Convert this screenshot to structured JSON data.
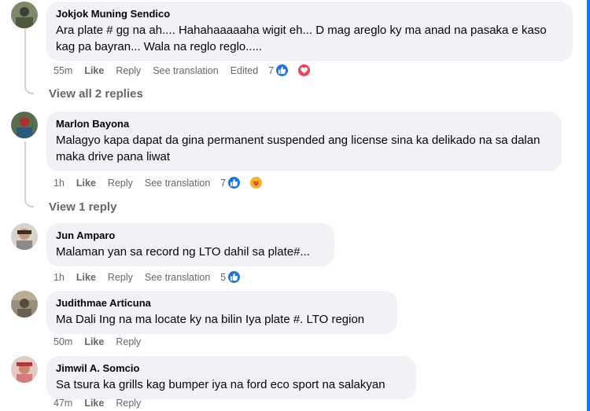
{
  "comments": [
    {
      "author": "Jokjok Muning Sendico",
      "text": "Ara plate # gg na ah.... Hahahaaaaaha wigit eh... D mag areglo ky ma anad na pasaka e kaso kag pa bayran... Wala na reglo reglo.....",
      "time": "55m",
      "like": "Like",
      "reply": "Reply",
      "translate": "See translation",
      "edited": "Edited",
      "reaction_count": "7",
      "reactions": [
        "like-icon",
        "love-icon"
      ],
      "view_replies": "View all 2 replies"
    },
    {
      "author": "Marlon Bayona",
      "text": "Malagyo kapa dapat da gina permanent suspended ang license sina ka delikado na sa dalan maka drive pana liwat",
      "time": "1h",
      "like": "Like",
      "reply": "Reply",
      "translate": "See translation",
      "reaction_count": "7",
      "reactions": [
        "like-icon",
        "care-icon"
      ],
      "view_replies": "View 1 reply"
    },
    {
      "author": "Jun Amparo",
      "text": "Malaman yan sa record ng LTO dahil sa plate#...",
      "time": "1h",
      "like": "Like",
      "reply": "Reply",
      "translate": "See translation",
      "reaction_count": "5",
      "reactions": [
        "like-icon"
      ]
    },
    {
      "author": "Judithmae Articuna",
      "text": "Ma Dali Ing na ma locate ky na bilin Iya plate #. LTO region",
      "time": "50m",
      "like": "Like",
      "reply": "Reply"
    },
    {
      "author": "Jimwil A. Somcio",
      "text": "Sa tsura ka grills kag bumper iya na ford eco sport na salakyan",
      "time": "47m",
      "like": "Like",
      "reply": "Reply"
    }
  ],
  "colors": {
    "bubble": "#f0f2f5",
    "secondary_text": "#65676b",
    "like_blue": "#1b74e4",
    "love_red": "#f33e58",
    "care_yellow": "#f7b125",
    "frame_blue": "#1877f2"
  }
}
